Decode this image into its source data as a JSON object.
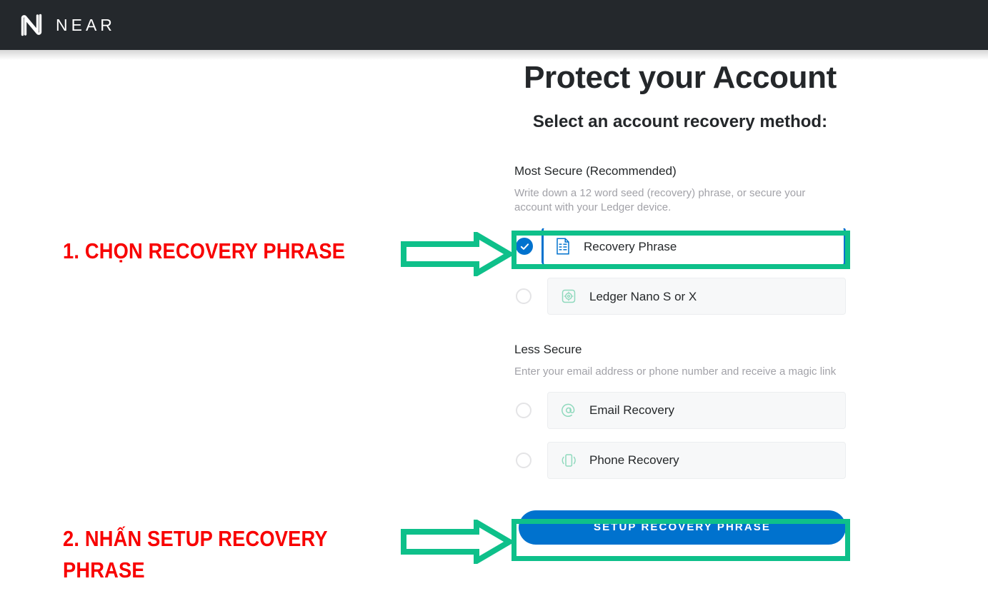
{
  "header": {
    "logo_icon": "near-logo-mark",
    "brand": "NEAR"
  },
  "main": {
    "title": "Protect your Account",
    "subtitle": "Select an account recovery method:",
    "sections": [
      {
        "id": "most-secure",
        "title": "Most Secure (Recommended)",
        "description": "Write down a 12 word seed (recovery) phrase, or secure your account with your Ledger device.",
        "options": [
          {
            "id": "recovery-phrase",
            "label": "Recovery Phrase",
            "icon": "document-icon",
            "selected": true
          },
          {
            "id": "ledger",
            "label": "Ledger Nano S or X",
            "icon": "ledger-device-icon",
            "selected": false
          }
        ]
      },
      {
        "id": "less-secure",
        "title": "Less Secure",
        "description": "Enter your email address or phone number and receive a magic link",
        "options": [
          {
            "id": "email-recovery",
            "label": "Email Recovery",
            "icon": "at-sign-icon",
            "selected": false
          },
          {
            "id": "phone-recovery",
            "label": "Phone Recovery",
            "icon": "mobile-phone-icon",
            "selected": false
          }
        ]
      }
    ],
    "submit_label": "SETUP RECOVERY PHRASE"
  },
  "annotations": [
    {
      "id": "step-1",
      "text": "1. CHỌN RECOVERY PHRASE",
      "arrow": "right-arrow-outline"
    },
    {
      "id": "step-2",
      "text": "2. NHẤN SETUP RECOVERY\nPHRASE",
      "arrow": "right-arrow-outline"
    }
  ],
  "colors": {
    "header_bg": "#24282c",
    "accent_blue": "#0072ce",
    "annotation_green": "#0ec08a",
    "annotation_red": "#f80000",
    "icon_green": "#8fd9bd",
    "text_dark": "#25282a",
    "text_muted": "#a2a2a8"
  }
}
